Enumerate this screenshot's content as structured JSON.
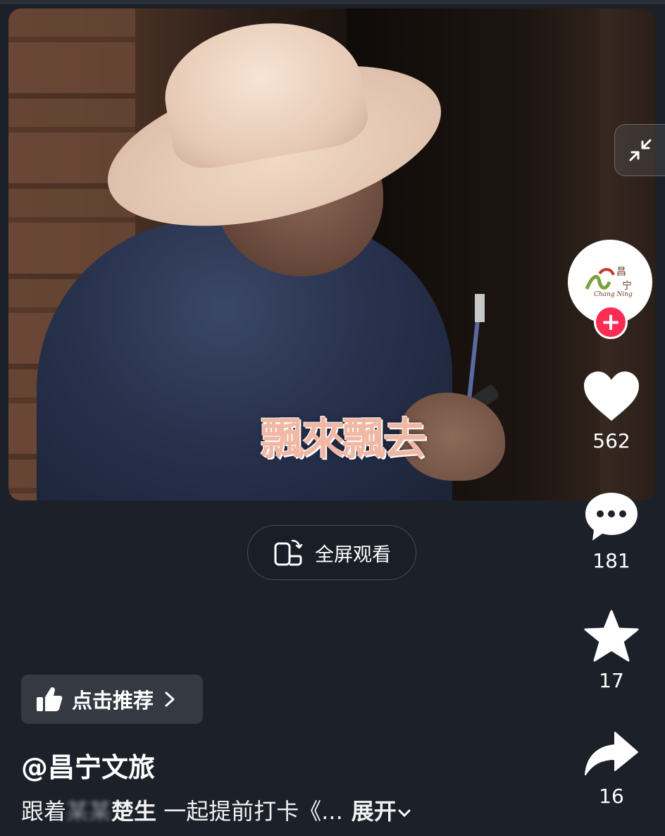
{
  "video": {
    "subtitle": "飄來飄去"
  },
  "avatar": {
    "logo_text_top": "昌",
    "logo_text_latin": "Chang Ning",
    "logo_text_bottom": "宁",
    "follow_symbol": "+"
  },
  "actions": {
    "likes": "562",
    "comments": "181",
    "favorites": "17",
    "shares": "16"
  },
  "fullscreen_label": "全屏观看",
  "recommend_label": "点击推荐",
  "author": "@昌宁文旅",
  "description": {
    "prefix": "跟着",
    "blurred": "某某",
    "name": "楚生",
    "rest": " 一起提前打卡《...",
    "expand": "展开"
  },
  "colors": {
    "background": "#1c2029",
    "follow": "#fe2c55",
    "subtitle": "#f0b8a4"
  }
}
